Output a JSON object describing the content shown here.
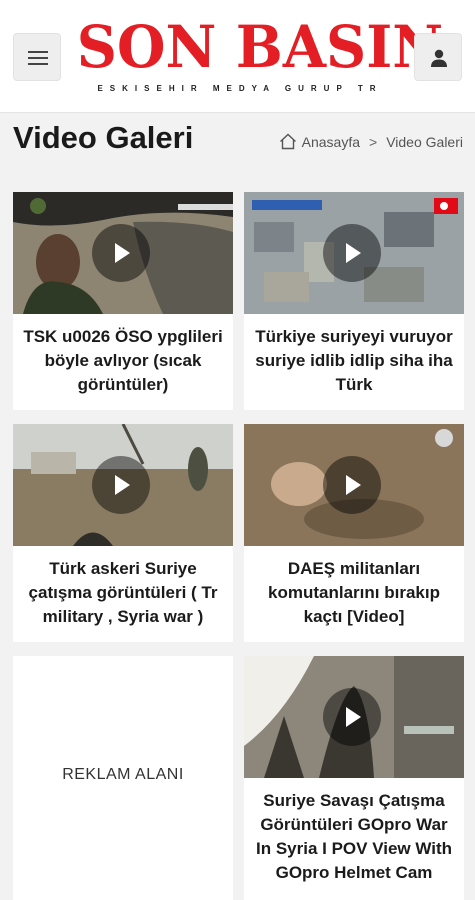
{
  "header": {
    "logo_text": "SON BASIN",
    "logo_subtitle": "ESKISEHIR MEDYA GURUP TR",
    "menu_icon": "hamburger-icon",
    "user_icon": "user-icon",
    "logo_color": "#e31e24"
  },
  "page": {
    "title": "Video Galeri"
  },
  "breadcrumb": {
    "home_icon": "home-icon",
    "home_label": "Anasayfa",
    "separator": ">",
    "current": "Video Galeri"
  },
  "videos": [
    {
      "title": "TSK u0026 ÖSO ypglileri böyle avlıyor (sıcak görüntüler)"
    },
    {
      "title": "Türkiye suriyeyi vuruyor suriye idlib idlip siha iha Türk"
    },
    {
      "title": "Türk askeri Suriye çatışma görüntüleri ( Tr military , Syria war )"
    },
    {
      "title": "DAEŞ militanları komutanlarını bırakıp kaçtı [Video]"
    },
    {
      "title": "Suriye Savaşı Çatışma Görüntüleri GOpro War In Syria I POV View With GOpro Helmet Cam"
    }
  ],
  "ad": {
    "label": "REKLAM ALANI"
  }
}
